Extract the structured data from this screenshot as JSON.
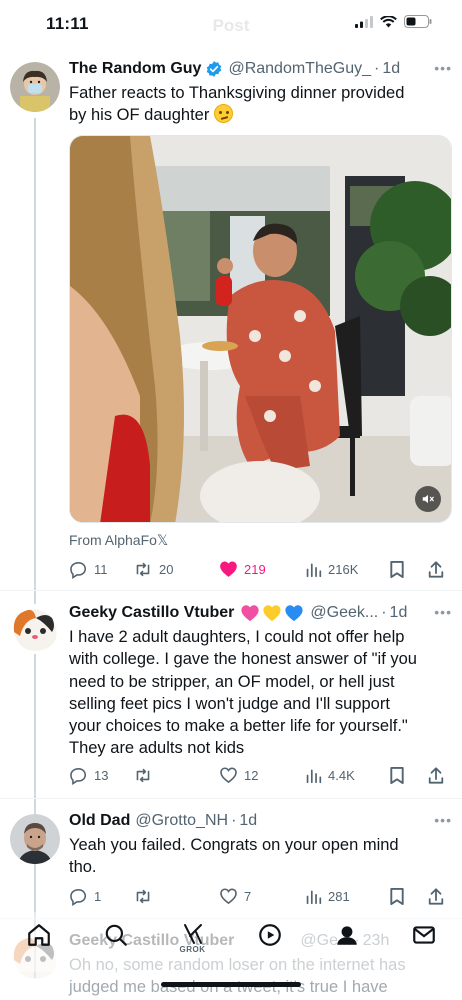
{
  "status_bar": {
    "time": "11:11",
    "ghost_title": "Post"
  },
  "tweets": [
    {
      "name": "The Random Guy",
      "verified": true,
      "handle": "@RandomTheGuy_",
      "time": "1d",
      "text_line1": "Father reacts to Thanksgiving dinner provided",
      "text_line2": "by his OF daughter",
      "emoji": "confused-face-emoji",
      "source": "From AlphaFo𝕏",
      "stats": {
        "replies": "11",
        "retweets": "20",
        "likes": "219",
        "views": "216K"
      }
    },
    {
      "name": "Geeky Castillo Vtuber",
      "name_emojis": [
        "pink-heart",
        "yellow-heart",
        "blue-heart"
      ],
      "handle": "@Geek...",
      "time": "1d",
      "text_lines": [
        "I have 2 adult daughters, I could not offer help",
        "with college. I gave the honest answer of \"if you",
        "need to be stripper, an OF model, or hell just",
        "selling feet pics I won't judge and I'll support",
        "your choices to make a better life for yourself.\"",
        "They are adults not kids"
      ],
      "stats": {
        "replies": "13",
        "retweets": "",
        "likes": "12",
        "views": "4.4K"
      }
    },
    {
      "name": "Old Dad",
      "handle": "@Grotto_NH",
      "time": "1d",
      "text_lines": [
        "Yeah you failed. Congrats on your open mind",
        "tho."
      ],
      "stats": {
        "replies": "1",
        "retweets": "",
        "likes": "7",
        "views": "281"
      }
    },
    {
      "name": "Geeky Castillo Vtuber",
      "handle": "@Ge...",
      "time": "23h",
      "text_lines": [
        "Oh no, some random loser on the internet has",
        "judged me based on a tweet, it's true I have"
      ]
    }
  ],
  "bottom_nav": {
    "items": [
      "home-icon",
      "search-icon",
      "grok-icon",
      "spaces-icon",
      "communities-icon",
      "messages-icon"
    ],
    "grok_label": "GROK"
  },
  "colors": {
    "verified_blue": "#1d9bf0",
    "like_pink": "#f91880",
    "muted_gray": "#536471"
  }
}
